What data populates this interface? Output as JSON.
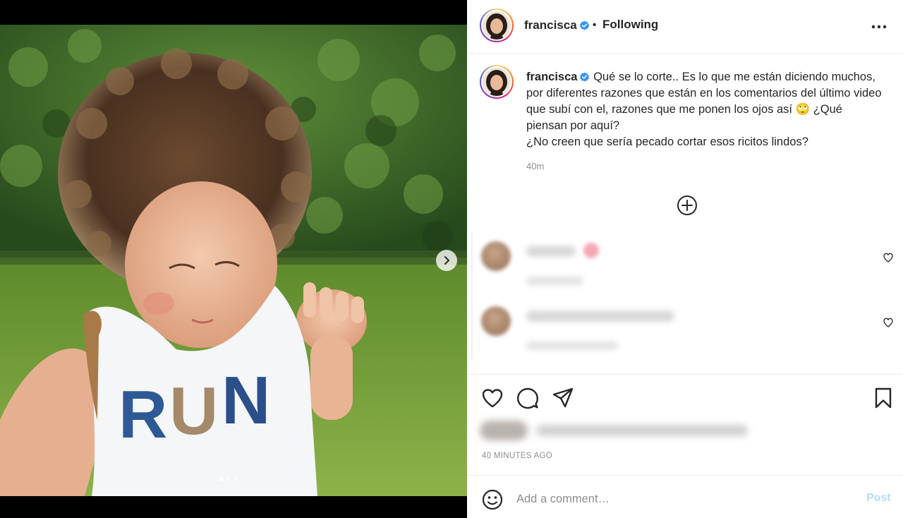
{
  "post": {
    "image_alt": "Toddler with curly hair wearing a RUN tank top on grass",
    "shirt_text": "RUN",
    "carousel": {
      "total": 3,
      "active": 1
    }
  },
  "header": {
    "username": "francisca",
    "separator": "•",
    "follow_status": "Following"
  },
  "caption": {
    "username": "francisca",
    "text_line1": "Qué se lo corte.. Es lo que me están diciendo muchos, por diferentes razones que están en los comentarios del último video que subí con el, razones que me ponen los ojos así 🙄 ¿Qué piensan por aquí?",
    "text_line2": "¿No creen que sería pecado cortar esos ricitos lindos?",
    "time": "40m"
  },
  "meta": {
    "post_age": "40 MINUTES AGO"
  },
  "add_comment": {
    "placeholder": "Add a comment…",
    "post_label": "Post"
  },
  "colors": {
    "accent_blue": "#0095f6",
    "verified_blue": "#3897f0",
    "post_disabled": "#b2dffc",
    "secondary_text": "#8e8e8e"
  },
  "icons": [
    "chevron-right-icon",
    "verified-icon",
    "more-options-icon",
    "add-circle-icon",
    "heart-icon",
    "comment-icon",
    "share-icon",
    "bookmark-icon",
    "emoji-icon"
  ]
}
